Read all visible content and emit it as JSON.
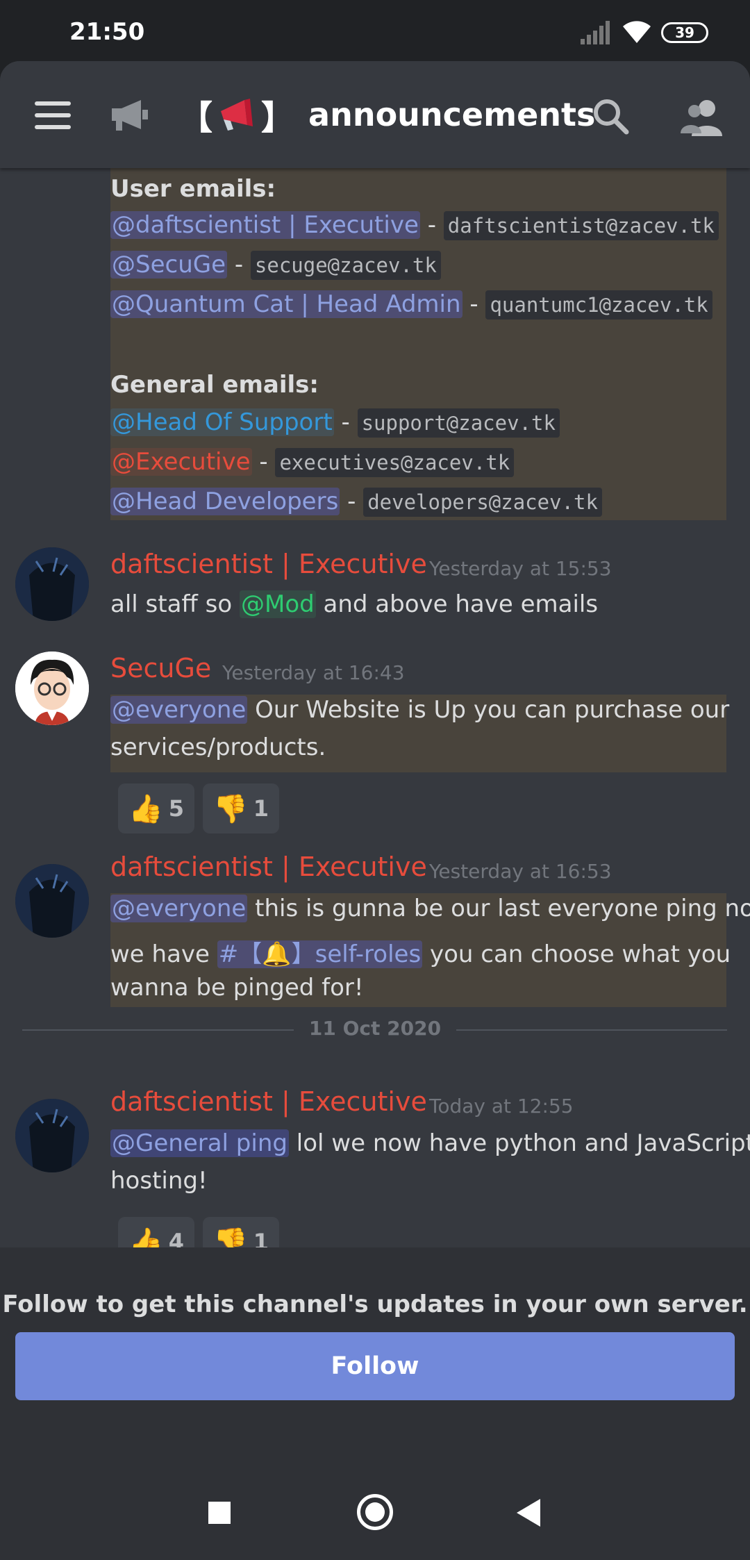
{
  "status_bar": {
    "time": "21:50",
    "battery": "39"
  },
  "header": {
    "title": "announcements",
    "bracket_open": "【",
    "bracket_close": "】"
  },
  "emails_block": {
    "user_heading": "User emails:",
    "user_emails": [
      {
        "mention": "@daftscientist | Executive",
        "sep": "-",
        "email": "daftscientist@zacev.tk"
      },
      {
        "mention": "@SecuGe",
        "sep": "-",
        "email": "secuge@zacev.tk"
      },
      {
        "mention": "@Quantum Cat | Head Admin",
        "sep": "-",
        "email": "quantumc1@zacev.tk"
      }
    ],
    "general_heading": "General emails:",
    "general_emails": [
      {
        "mention": "@Head Of Support",
        "sep": "-",
        "email": "support@zacev.tk"
      },
      {
        "mention": "@Executive",
        "sep": "-",
        "email": "executives@zacev.tk"
      },
      {
        "mention": "@Head Developers",
        "sep": "-",
        "email": "developers@zacev.tk"
      }
    ]
  },
  "messages": [
    {
      "author": "daftscientist | Executive",
      "timestamp": "Yesterday at 15:53",
      "text_before": "all staff so",
      "mention": "@Mod",
      "text_after": "and above have emails"
    },
    {
      "author": "SecuGe",
      "timestamp": "Yesterday at 16:43",
      "mention": "@everyone",
      "line1": "Our Website is Up you can purchase our",
      "line2": "services/products.",
      "reactions": [
        {
          "emoji": "👍",
          "count": "5"
        },
        {
          "emoji": "👎",
          "count": "1"
        }
      ]
    },
    {
      "author": "daftscientist | Executive",
      "timestamp": "Yesterday at 16:53",
      "mention": "@everyone",
      "line1": "this is gunna be our last everyone ping now",
      "line2_before": "we have",
      "channel": "#【🔔】self-roles",
      "line2_after": "you can choose what you",
      "line3": "wanna be pinged for!"
    },
    {
      "author": "daftscientist | Executive",
      "timestamp": "Today at 12:55",
      "mention": "@General ping",
      "line1": "lol we now have python and JavaScript",
      "line2": "hosting!",
      "reactions": [
        {
          "emoji": "👍",
          "count": "4"
        },
        {
          "emoji": "👎",
          "count": "1"
        }
      ]
    }
  ],
  "date_divider": "11 Oct 2020",
  "follow": {
    "message": "Follow to get this channel's updates in your own server.",
    "button": "Follow"
  },
  "colors": {
    "accent": "#7289da",
    "executive_red": "#e74c3c",
    "mod_green": "#2ecc71",
    "support_blue": "#3498db"
  }
}
